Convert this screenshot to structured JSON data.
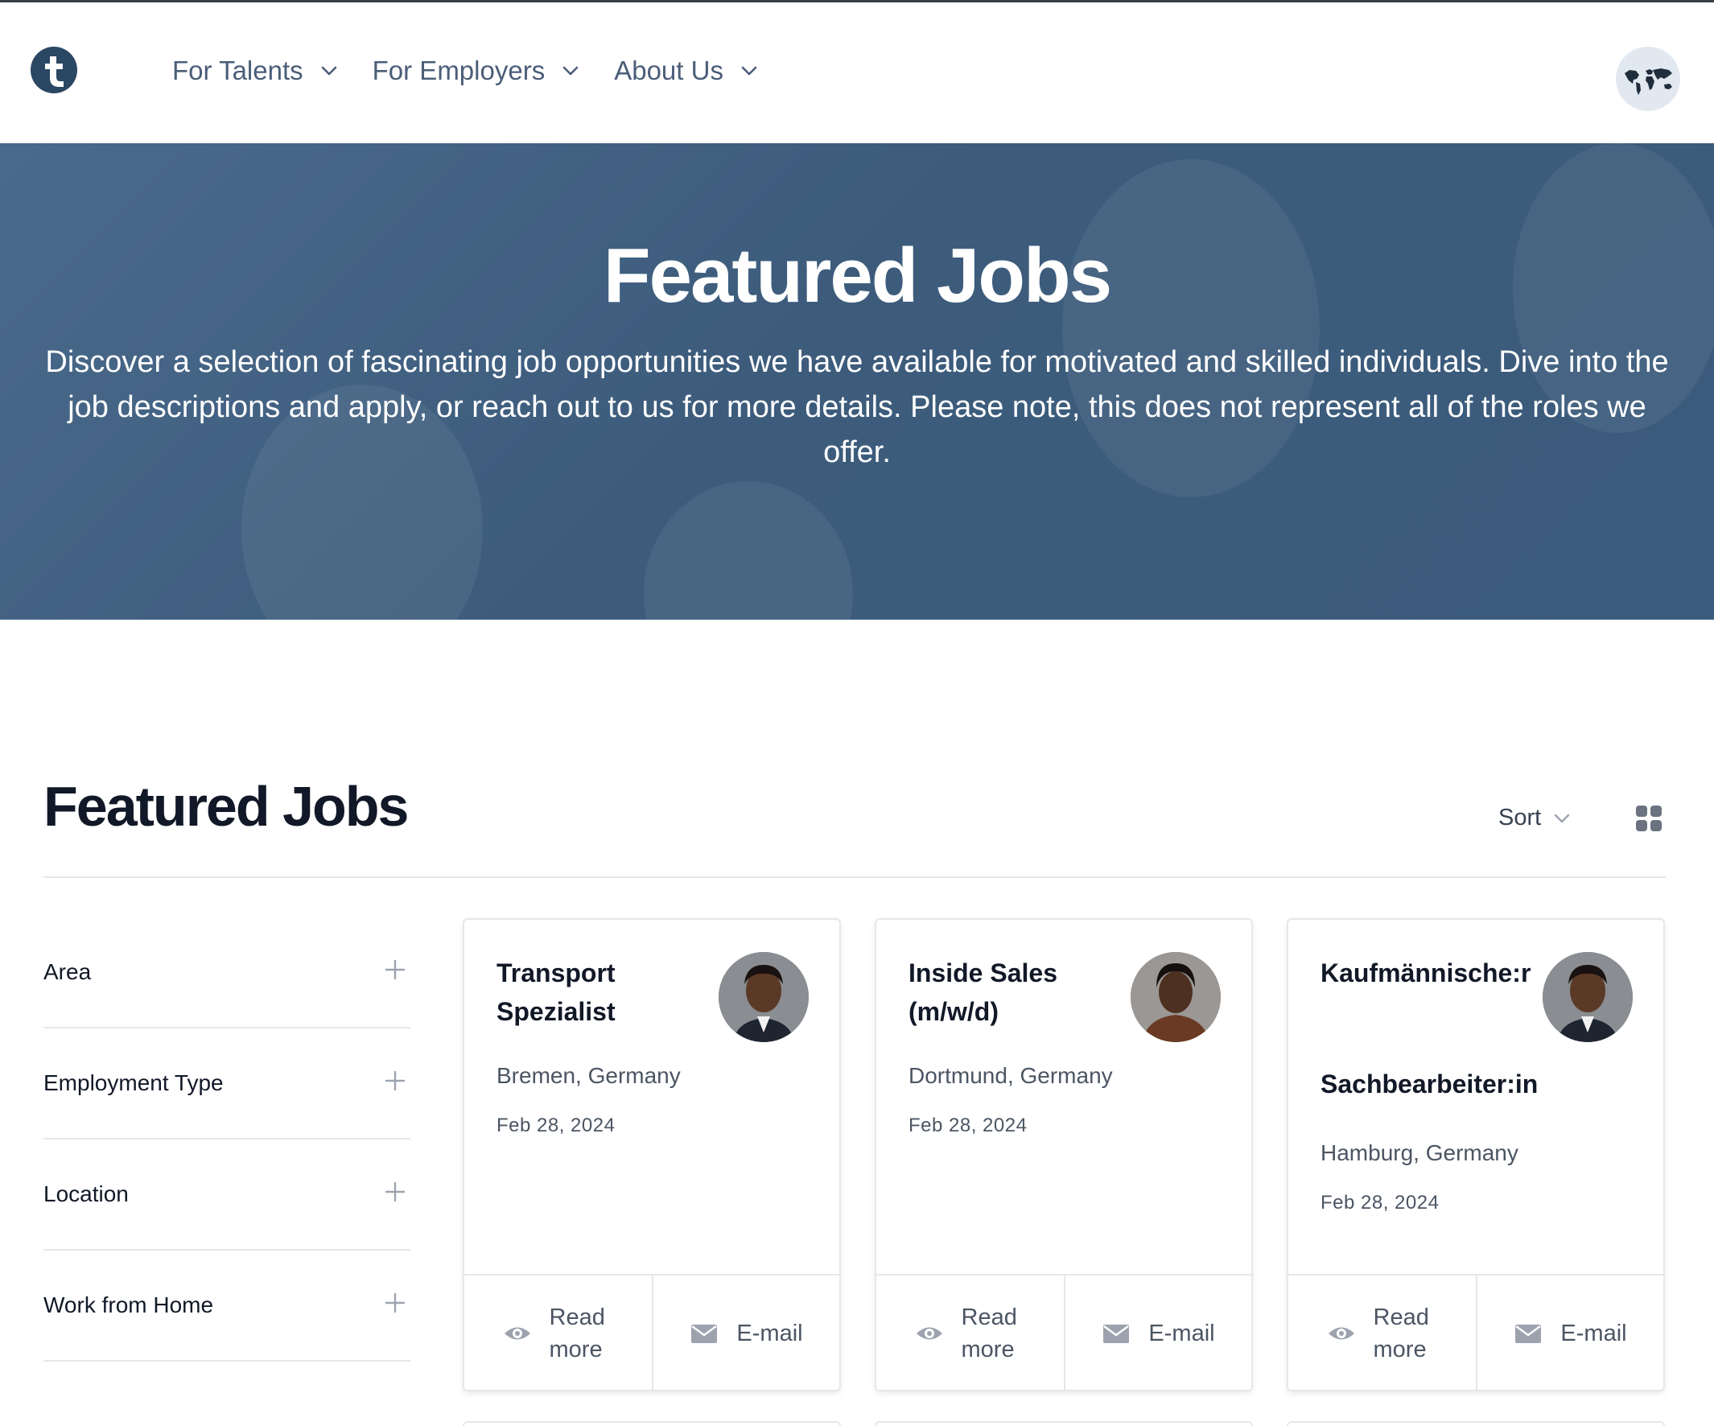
{
  "header": {
    "nav": [
      {
        "label": "For Talents"
      },
      {
        "label": "For Employers"
      },
      {
        "label": "About Us"
      }
    ]
  },
  "hero": {
    "title": "Featured Jobs",
    "text": "Discover a selection of fascinating job opportunities we have available for motivated and skilled individuals. Dive into the job descriptions and apply, or reach out to us for more details. Please note, this does not represent all of the roles we offer."
  },
  "section": {
    "title": "Featured Jobs",
    "sort_label": "Sort"
  },
  "filters": [
    {
      "label": "Area"
    },
    {
      "label": "Employment Type"
    },
    {
      "label": "Location"
    },
    {
      "label": "Work from Home"
    }
  ],
  "jobs": [
    {
      "title": "Transport Spezialist",
      "location": "Bremen, Germany",
      "date": "Feb 28, 2024",
      "read_label": "Read more",
      "email_label": "E-mail"
    },
    {
      "title": "Inside Sales (m/w/d)",
      "location": "Dortmund, Germany",
      "date": "Feb 28, 2024",
      "read_label": "Read more",
      "email_label": "E-mail"
    },
    {
      "title": "Kaufmännische:r",
      "title_line2": "Sachbearbeiter:in",
      "location": "Hamburg, Germany",
      "date": "Feb 28, 2024",
      "read_label": "Read more",
      "email_label": "E-mail"
    }
  ],
  "colors": {
    "hero_bg": "#3d5c7c",
    "brand": "#2a4763",
    "nav_text": "#4b5d78"
  },
  "icons": [
    "logo-t-icon",
    "chevron-down-icon",
    "world-map-icon",
    "grid-view-icon",
    "plus-icon",
    "eye-icon",
    "envelope-icon"
  ]
}
